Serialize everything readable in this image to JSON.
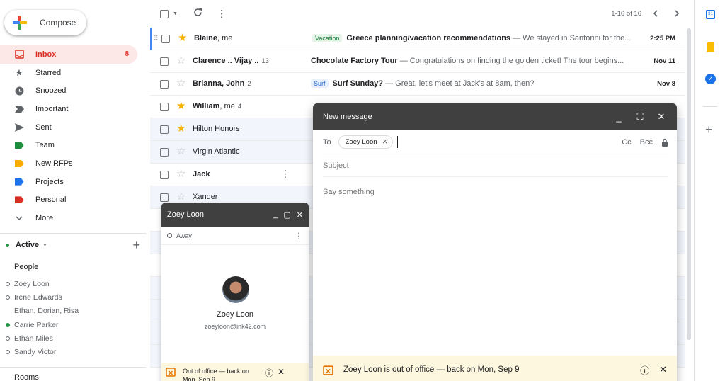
{
  "compose_label": "Compose",
  "nav": [
    {
      "label": "Inbox",
      "count": "8",
      "icon": "inbox-icon",
      "active": true
    },
    {
      "label": "Starred",
      "icon": "star-icon"
    },
    {
      "label": "Snoozed",
      "icon": "clock-icon"
    },
    {
      "label": "Important",
      "icon": "important-icon"
    },
    {
      "label": "Sent",
      "icon": "send-icon"
    },
    {
      "label": "Team",
      "icon": "label-icon",
      "color": "#1e8e3e"
    },
    {
      "label": "New RFPs",
      "icon": "label-icon",
      "color": "#f9ab00"
    },
    {
      "label": "Projects",
      "icon": "label-icon",
      "color": "#1a73e8"
    },
    {
      "label": "Personal",
      "icon": "label-icon",
      "color": "#d93025"
    },
    {
      "label": "More",
      "icon": "chevron-down-icon"
    }
  ],
  "chat": {
    "status_label": "Active",
    "people_header": "People",
    "people": [
      {
        "name": "Zoey Loon",
        "status": "away"
      },
      {
        "name": "Irene Edwards",
        "status": "away"
      },
      {
        "name": "Ethan, Dorian, Risa",
        "status": "none"
      },
      {
        "name": "Carrie Parker",
        "status": "online"
      },
      {
        "name": "Ethan Miles",
        "status": "away"
      },
      {
        "name": "Sandy Victor",
        "status": "away"
      }
    ],
    "rooms_header": "Rooms"
  },
  "toolbar": {
    "page_info": "1-16 of 16"
  },
  "emails": [
    {
      "sender": "Blaine",
      "sender_rest": ", me",
      "count": "",
      "starred": true,
      "unread": true,
      "label": "Vacation",
      "label_bg": "#e6f4ea",
      "label_fg": "#188038",
      "subject": "Greece planning/vacation recommendations",
      "snippet": " — We stayed in Santorini for the...",
      "date": "2:25 PM"
    },
    {
      "sender": "Clarence .. Vijay ..",
      "sender_rest": "",
      "count": "13",
      "starred": false,
      "unread": true,
      "label": "",
      "subject": "Chocolate Factory Tour",
      "snippet": " — Congratulations on finding the golden ticket! The tour begins...",
      "date": "Nov 11"
    },
    {
      "sender": "Brianna, John",
      "sender_rest": "",
      "count": "2",
      "starred": false,
      "unread": true,
      "label": "Surf",
      "label_bg": "#e8f0fe",
      "label_fg": "#1967d2",
      "subject": "Surf Sunday?",
      "snippet": " — Great, let's meet at Jack's at 8am, then?",
      "date": "Nov 8"
    },
    {
      "sender": "William",
      "sender_rest": ", me",
      "count": "4",
      "starred": true,
      "unread": true,
      "label": "",
      "subject": "",
      "snippet": "",
      "date": ""
    },
    {
      "sender": "Hilton Honors",
      "sender_rest": "",
      "count": "",
      "starred": true,
      "unread": false,
      "label": "",
      "subject": "",
      "snippet": "",
      "date": ""
    },
    {
      "sender": "Virgin Atlantic",
      "sender_rest": "",
      "count": "",
      "starred": false,
      "unread": false,
      "label": "",
      "subject": "",
      "snippet": "",
      "date": ""
    },
    {
      "sender": "Jack",
      "sender_rest": "",
      "count": "",
      "starred": false,
      "unread": true,
      "label": "",
      "subject": "",
      "snippet": "",
      "date": ""
    },
    {
      "sender": "Xander",
      "sender_rest": "",
      "count": "",
      "starred": false,
      "unread": false,
      "label": "",
      "subject": "",
      "snippet": "",
      "date": ""
    }
  ],
  "compose": {
    "title": "New message",
    "to_label": "To",
    "recipient": "Zoey Loon",
    "cc": "Cc",
    "bcc": "Bcc",
    "subject_placeholder": "Subject",
    "body_placeholder": "Say something",
    "ooo_text": "Zoey Loon is out of office — back on Mon, Sep 9"
  },
  "contact_card": {
    "title": "Zoey Loon",
    "status": "Away",
    "name": "Zoey Loon",
    "email": "zoeyloon@ink42.com",
    "ooo_text": "Out of office — back on Mon, Sep 9"
  }
}
